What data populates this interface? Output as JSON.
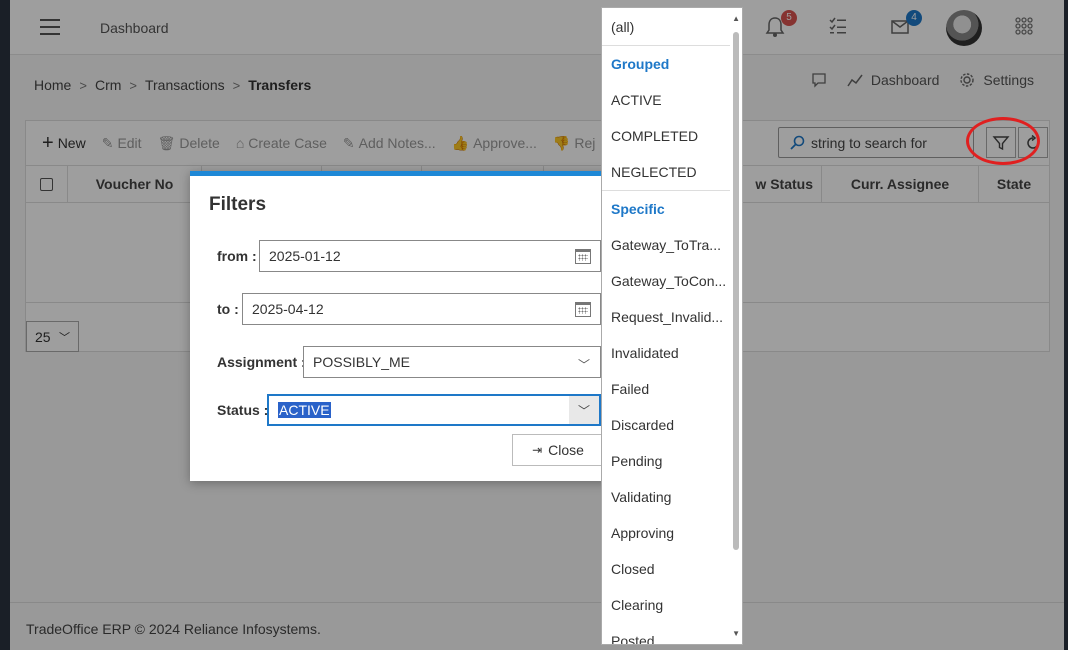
{
  "app": {
    "title": "Dashboard"
  },
  "topbar": {
    "notifications_count": "5",
    "messages_count": "4"
  },
  "breadcrumb": [
    "Home",
    "Crm",
    "Transactions",
    "Transfers"
  ],
  "header_actions": {
    "dashboard": "Dashboard",
    "settings": "Settings"
  },
  "toolbar": {
    "new": "New",
    "edit": "Edit",
    "delete": "Delete",
    "create_case": "Create Case",
    "add_notes": "Add Notes...",
    "approve": "Approve...",
    "reject": "Rej"
  },
  "search": {
    "placeholder": "string to search for"
  },
  "table": {
    "headers": [
      "Voucher No",
      "w Status",
      "Curr. Assignee",
      "State"
    ]
  },
  "pager": {
    "page_size": "25"
  },
  "footer": {
    "text": "TradeOffice ERP © 2024 Reliance Infosystems."
  },
  "filters": {
    "title": "Filters",
    "from_label": "from :",
    "from_value": "2025-01-12",
    "to_label": "to :",
    "to_value": "2025-04-12",
    "assignment_label": "Assignment :",
    "assignment_value": "POSSIBLY_ME",
    "status_label": "Status :",
    "status_value": "ACTIVE",
    "close_label": "Close"
  },
  "status_dropdown": {
    "items": [
      {
        "label": "(all)"
      },
      {
        "label": "Grouped",
        "group": true
      },
      {
        "label": "ACTIVE"
      },
      {
        "label": "COMPLETED"
      },
      {
        "label": "NEGLECTED"
      },
      {
        "label": "Specific",
        "group": true
      },
      {
        "label": "Gateway_ToTra..."
      },
      {
        "label": "Gateway_ToCon..."
      },
      {
        "label": "Request_Invalid..."
      },
      {
        "label": "Invalidated"
      },
      {
        "label": "Failed"
      },
      {
        "label": "Discarded"
      },
      {
        "label": "Pending"
      },
      {
        "label": "Validating"
      },
      {
        "label": "Approving"
      },
      {
        "label": "Closed"
      },
      {
        "label": "Clearing"
      },
      {
        "label": "Posted"
      }
    ]
  },
  "colors": {
    "accent": "#1e88d6",
    "highlight": "#2a62c9",
    "annotation": "#e02020",
    "badge_red": "#d9534f",
    "badge_blue": "#1e78c8"
  }
}
